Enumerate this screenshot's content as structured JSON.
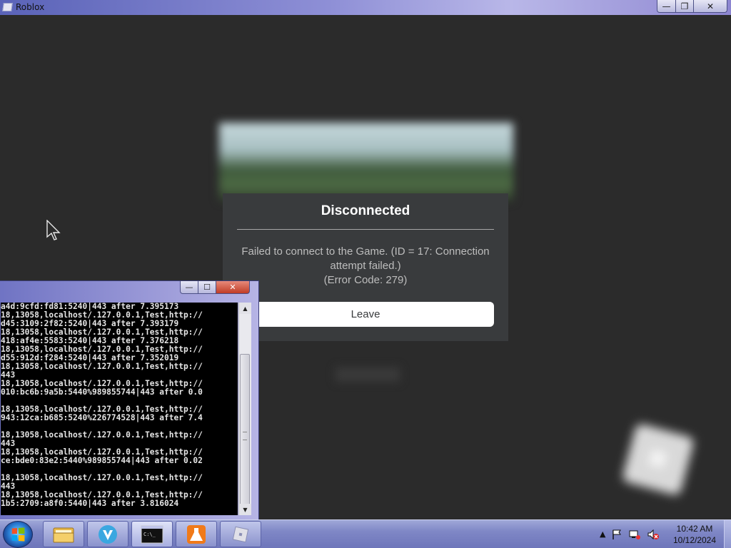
{
  "window": {
    "title": "Roblox",
    "minimize": "—",
    "restore": "❐",
    "close": "✕"
  },
  "dialog": {
    "title": "Disconnected",
    "message_line1": "Failed to connect to the Game. (ID = 17: Connection",
    "message_line2": "attempt failed.)",
    "error_code": "(Error Code: 279)",
    "leave_label": "Leave"
  },
  "console": {
    "minimize": "—",
    "restore": "☐",
    "close": "✕",
    "lines": "a4d:9cfd:fd81:5240|443 after 7.395173\n18,13058,localhost/.127.0.0.1,Test,http://\nd45:3109:2f82:5240|443 after 7.393179\n18,13058,localhost/.127.0.0.1,Test,http://\n418:af4e:5583:5240|443 after 7.376218\n18,13058,localhost/.127.0.0.1,Test,http://\nd55:912d:f284:5240|443 after 7.352019\n18,13058,localhost/.127.0.0.1,Test,http://\n443\n18,13058,localhost/.127.0.0.1,Test,http://\n010:bc6b:9a5b:5440%989855744|443 after 0.0\n\n18,13058,localhost/.127.0.0.1,Test,http://\n943:12ca:b685:5240%226774528|443 after 7.4\n\n18,13058,localhost/.127.0.0.1,Test,http://\n443\n18,13058,localhost/.127.0.0.1,Test,http://\nce:bde0:83e2:5440%989855744|443 after 0.02\n\n18,13058,localhost/.127.0.0.1,Test,http://\n443\n18,13058,localhost/.127.0.0.1,Test,http://\n1b5:2709:a8f0:5440|443 after 3.816024"
  },
  "taskbar": {
    "items": [
      {
        "name": "file-explorer-icon"
      },
      {
        "name": "vpn-app-icon"
      },
      {
        "name": "command-prompt-icon"
      },
      {
        "name": "lab-flask-app-icon"
      },
      {
        "name": "roblox-icon"
      }
    ],
    "clock_time": "10:42 AM",
    "clock_date": "10/12/2024",
    "tray_chevron": "▲"
  },
  "colors": {
    "dialog_bg": "#393b3d",
    "leave_button_bg": "#ffffff",
    "game_bg": "#2b2b2b",
    "console_bg": "#000000"
  }
}
